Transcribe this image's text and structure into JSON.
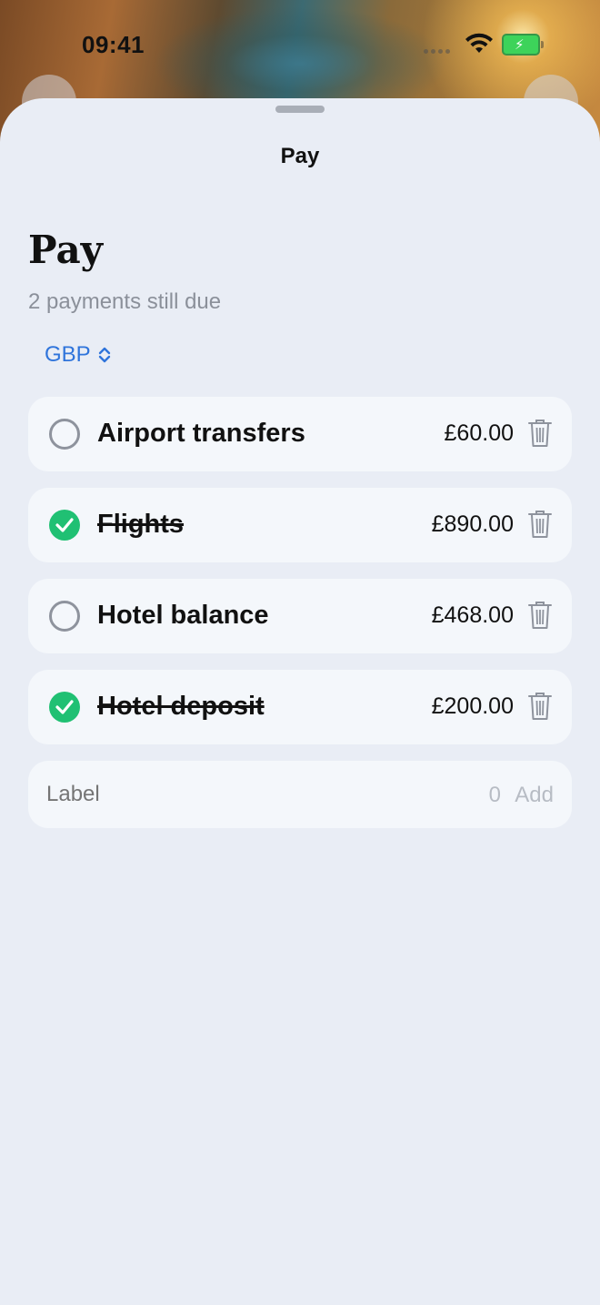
{
  "status_bar": {
    "time": "09:41"
  },
  "sheet": {
    "nav_title": "Pay",
    "title": "Pay",
    "subtitle": "2 payments still due",
    "currency": "GBP"
  },
  "payments": [
    {
      "label": "Airport transfers",
      "amount": "£60.00",
      "paid": false
    },
    {
      "label": "Flights",
      "amount": "£890.00",
      "paid": true
    },
    {
      "label": "Hotel balance",
      "amount": "£468.00",
      "paid": false
    },
    {
      "label": "Hotel deposit",
      "amount": "£200.00",
      "paid": true
    }
  ],
  "add_form": {
    "label_placeholder": "Label",
    "amount_placeholder": "0",
    "add_label": "Add"
  },
  "colors": {
    "accent": "#2f74db",
    "paid_green": "#20c073",
    "sheet_bg": "#e9edf5",
    "card_bg": "#f4f7fb"
  },
  "icons": [
    "wifi-icon",
    "battery-icon",
    "chevron-updown-icon",
    "checkmark-icon",
    "trash-icon"
  ]
}
